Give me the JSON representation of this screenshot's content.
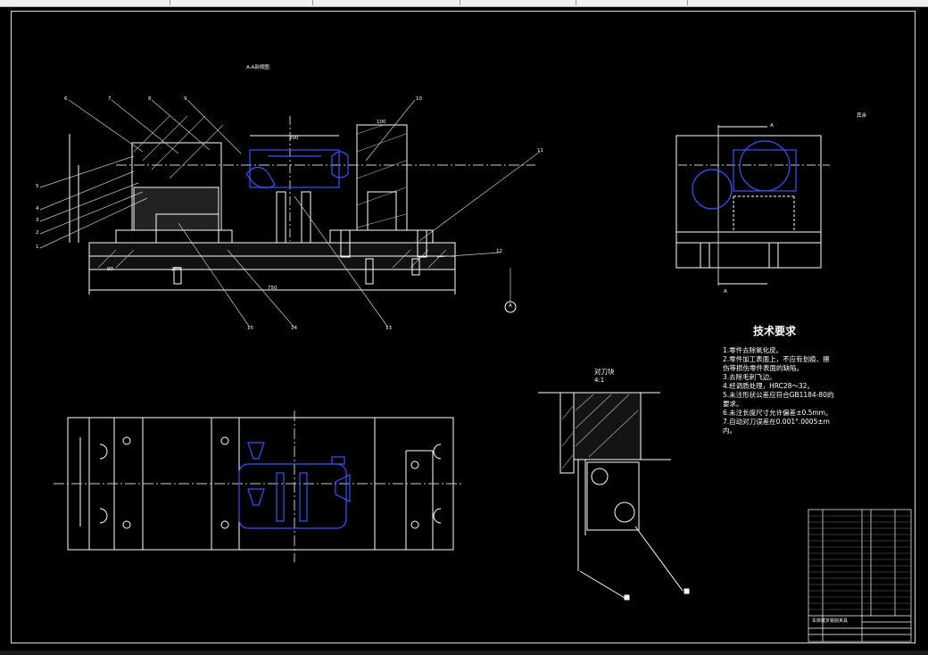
{
  "section_title": "A-A剖视图",
  "knife_block_title": "对刀块",
  "knife_block_scale": "4:1",
  "tech_title": "技术要求",
  "tech_lines": [
    "1.零件去除氧化皮。",
    "2.零件加工表面上，不应有划痕、擦",
    "伤等损伤零件表面的缺陷。",
    "3.去除毛刺飞边。",
    "4.经调质处理，HRC28～32。",
    "5.未注形状公差应符合GB1184-80的",
    "要求。",
    "6.未注长度尺寸允许偏差±0.5mm。",
    "7.自动对刀误差在0.001°.0005±m",
    "内。"
  ],
  "callouts": [
    "6",
    "7",
    "8",
    "9",
    "10",
    "11",
    "12",
    "13",
    "14",
    "15",
    "5",
    "4",
    "3",
    "2",
    "1"
  ],
  "dims": {
    "d200": "200",
    "d100": "100",
    "d750": "750",
    "d90": "90",
    "d200b": "200"
  },
  "section_mark": "A",
  "view_marker": "A",
  "surface_note": "其余",
  "title_block_name": "车床拨叉铣削夹具"
}
